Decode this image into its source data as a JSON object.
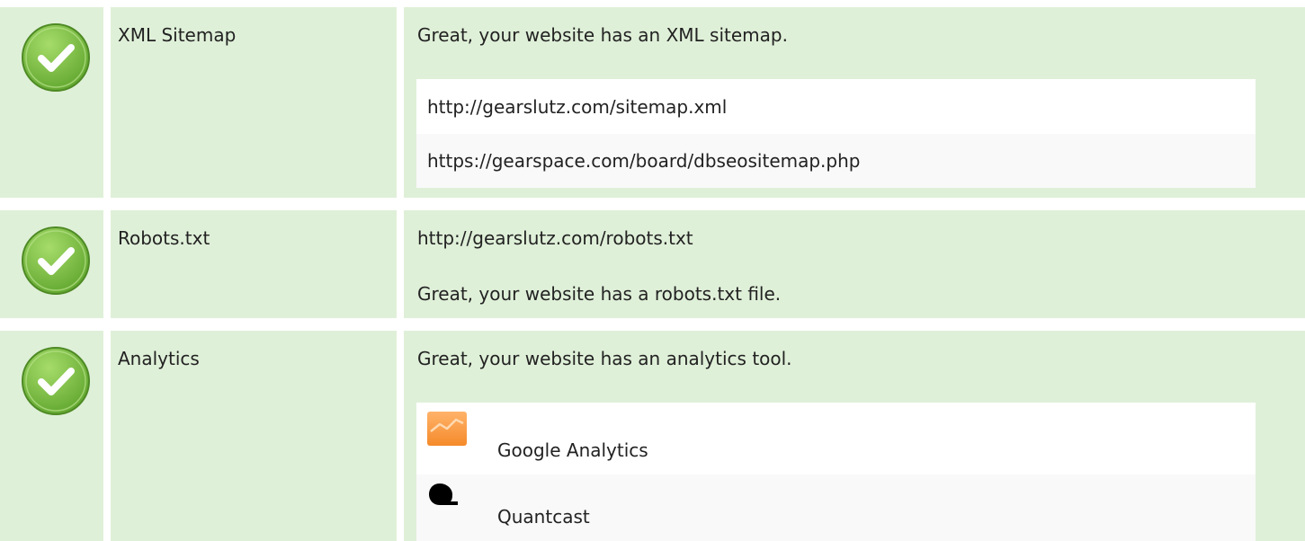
{
  "colors": {
    "pass_background": "#dff0d8",
    "check_green": "#7ac143",
    "text": "#222222"
  },
  "rows": [
    {
      "status_icon": "check-circle-icon",
      "label": "XML Sitemap",
      "message": "Great, your website has an XML sitemap.",
      "urls": [
        "http://gearslutz.com/sitemap.xml",
        "https://gearspace.com/board/dbseositemap.php"
      ]
    },
    {
      "status_icon": "check-circle-icon",
      "label": "Robots.txt",
      "url": "http://gearslutz.com/robots.txt",
      "message": "Great, your website has a robots.txt file."
    },
    {
      "status_icon": "check-circle-icon",
      "label": "Analytics",
      "message": "Great, your website has an analytics tool.",
      "tools": [
        {
          "icon": "google-analytics-icon",
          "name": "Google Analytics"
        },
        {
          "icon": "quantcast-icon",
          "name": "Quantcast"
        }
      ]
    }
  ]
}
